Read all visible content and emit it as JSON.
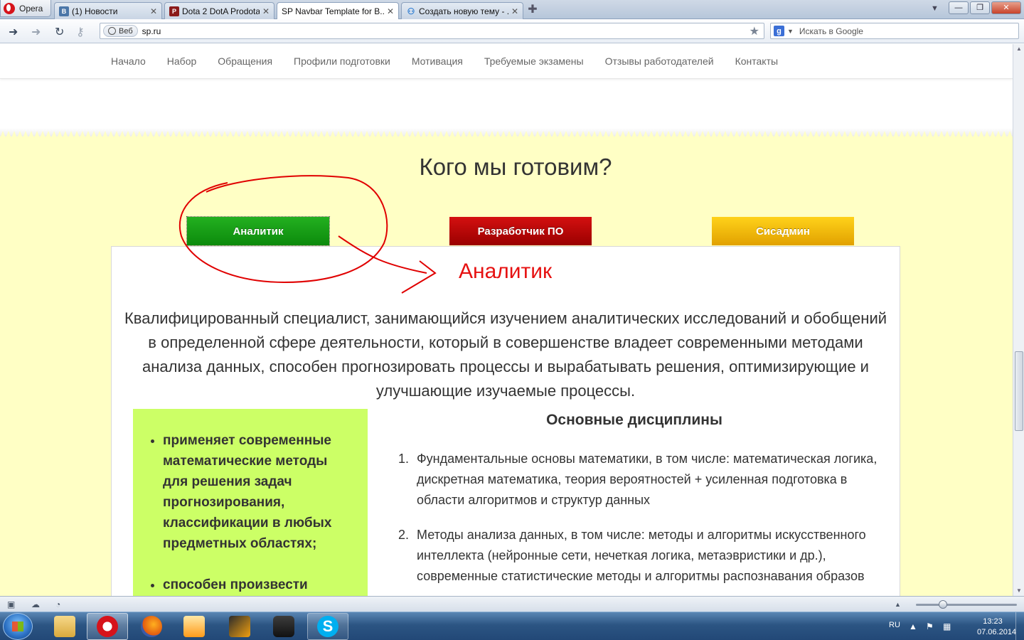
{
  "browser": {
    "menu_label": "Opera",
    "tabs": [
      {
        "title": "(1) Новости",
        "icon": "vk-icon",
        "fav": "B",
        "color": "#4a76a8"
      },
      {
        "title": "Dota 2 DotA Prodota",
        "icon": "prodota-icon",
        "fav": "P",
        "color": "#8b1a1a"
      },
      {
        "title": "SP Navbar Template for B...",
        "icon": "sp-icon",
        "fav": "",
        "color": "#ffffff"
      },
      {
        "title": "Создать новую тему - ...",
        "icon": "forum-icon",
        "fav": "",
        "color": "#2d7cd1"
      }
    ],
    "address": {
      "badge": "Веб",
      "url": "sp.ru"
    },
    "search": {
      "placeholder": "Искать в Google",
      "engine_letter": "g"
    }
  },
  "site": {
    "nav": [
      "Начало",
      "Набор",
      "Обращения",
      "Профили подготовки",
      "Мотивация",
      "Требуемые экзамены",
      "Отзывы работодателей",
      "Контакты"
    ],
    "section_title": "Кого мы готовим?",
    "roles": [
      {
        "label": "Аналитик",
        "color": "#0c8a0c"
      },
      {
        "label": "Разработчик ПО",
        "color": "#b00000"
      },
      {
        "label": "Сисадмин",
        "color": "#f2b800"
      }
    ],
    "card": {
      "title": "Аналитик",
      "description": "Квалифицированный специалист, занимающийся изучением аналитических исследований и обобщений в определенной сфере деятельности, который в совершенстве владеет современными методами анализа данных, способен прогнозировать процессы и вырабатывать решения, оптимизирующие и улучшающие изучаемые процессы.",
      "skills": [
        "применяет современные математические методы для решения задач прогнозирования, классификации в любых предметных областях;",
        "способен произвести"
      ],
      "disciplines_title": "Основные дисциплины",
      "disciplines": [
        "Фундаментальные основы математики, в том числе: математическая логика, дискретная математика, теория вероятностей + усиленная подготовка в области алгоритмов и структур данных",
        "Методы анализа данных, в том числе: методы и алгоритмы искусственного интеллекта (нейронные сети, нечеткая логика, метаэвристики и др.), современные статистические методы и алгоритмы распознавания образов"
      ]
    },
    "colors": {
      "yellow_bg": "#ffffc5",
      "green_box": "#ccff66",
      "accent_red": "#e61111"
    }
  },
  "taskbar": {
    "language": "RU",
    "time": "13:23",
    "date": "07.06.2014",
    "apps": [
      "explorer-icon",
      "opera-icon",
      "firefox-icon",
      "media-player-icon",
      "winamp-icon",
      "steam-icon",
      "skype-icon"
    ]
  }
}
